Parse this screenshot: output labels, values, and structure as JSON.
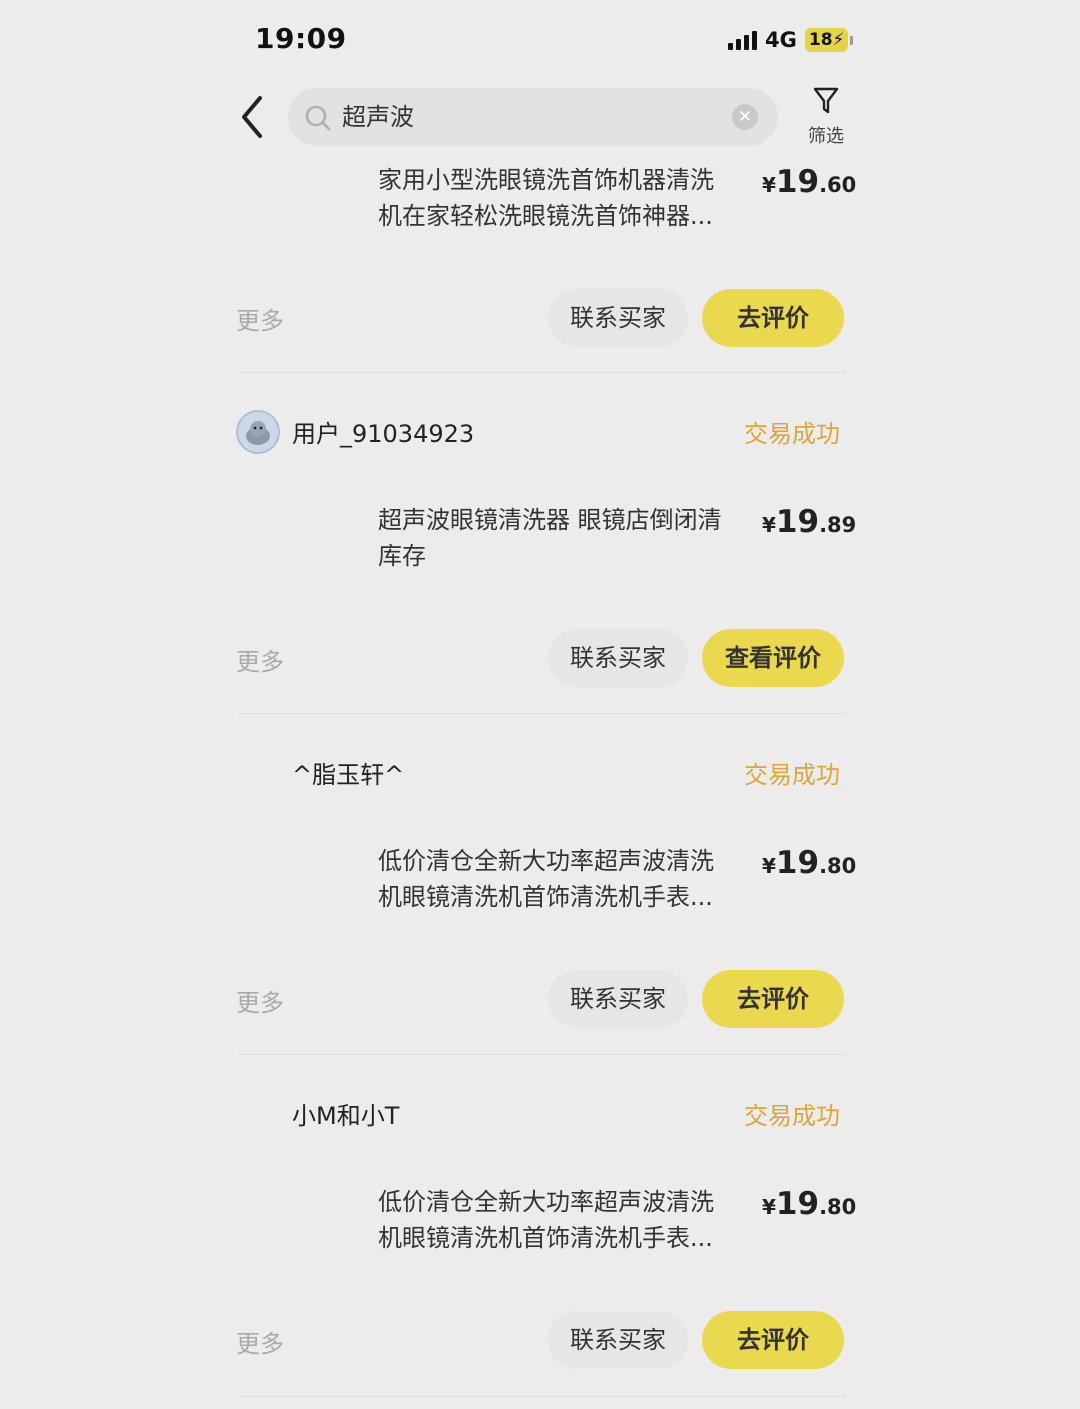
{
  "status_bar": {
    "time": "19:09",
    "network": "4G",
    "battery": "18"
  },
  "search": {
    "query": "超声波",
    "filter_label": "筛选"
  },
  "orders": [
    {
      "title_line1": "家用小型洗眼镜洗首饰机器清洗",
      "title_line2": "机在家轻松洗眼镜洗首饰神器...",
      "price_symbol": "¥",
      "price_int": "19",
      "price_dec": ".60",
      "more": "更多",
      "contact": "联系买家",
      "action": "去评价"
    },
    {
      "username": "用户_91034923",
      "status": "交易成功",
      "title_line1": "超声波眼镜清洗器 眼镜店倒闭清",
      "title_line2": "库存",
      "price_symbol": "¥",
      "price_int": "19",
      "price_dec": ".89",
      "more": "更多",
      "contact": "联系买家",
      "action": "查看评价"
    },
    {
      "username": "^脂玉轩^",
      "status": "交易成功",
      "title_line1": "低价清仓全新大功率超声波清洗",
      "title_line2": "机眼镜清洗机首饰清洗机手表...",
      "price_symbol": "¥",
      "price_int": "19",
      "price_dec": ".80",
      "more": "更多",
      "contact": "联系买家",
      "action": "去评价"
    },
    {
      "username": "小M和小T",
      "status": "交易成功",
      "title_line1": "低价清仓全新大功率超声波清洗",
      "title_line2": "机眼镜清洗机首饰清洗机手表...",
      "price_symbol": "¥",
      "price_int": "19",
      "price_dec": ".80",
      "more": "更多",
      "contact": "联系买家",
      "action": "去评价"
    }
  ],
  "colors": {
    "background": "#ececec",
    "accent_yellow": "#ead94e",
    "status_orange": "#e0a43a"
  }
}
